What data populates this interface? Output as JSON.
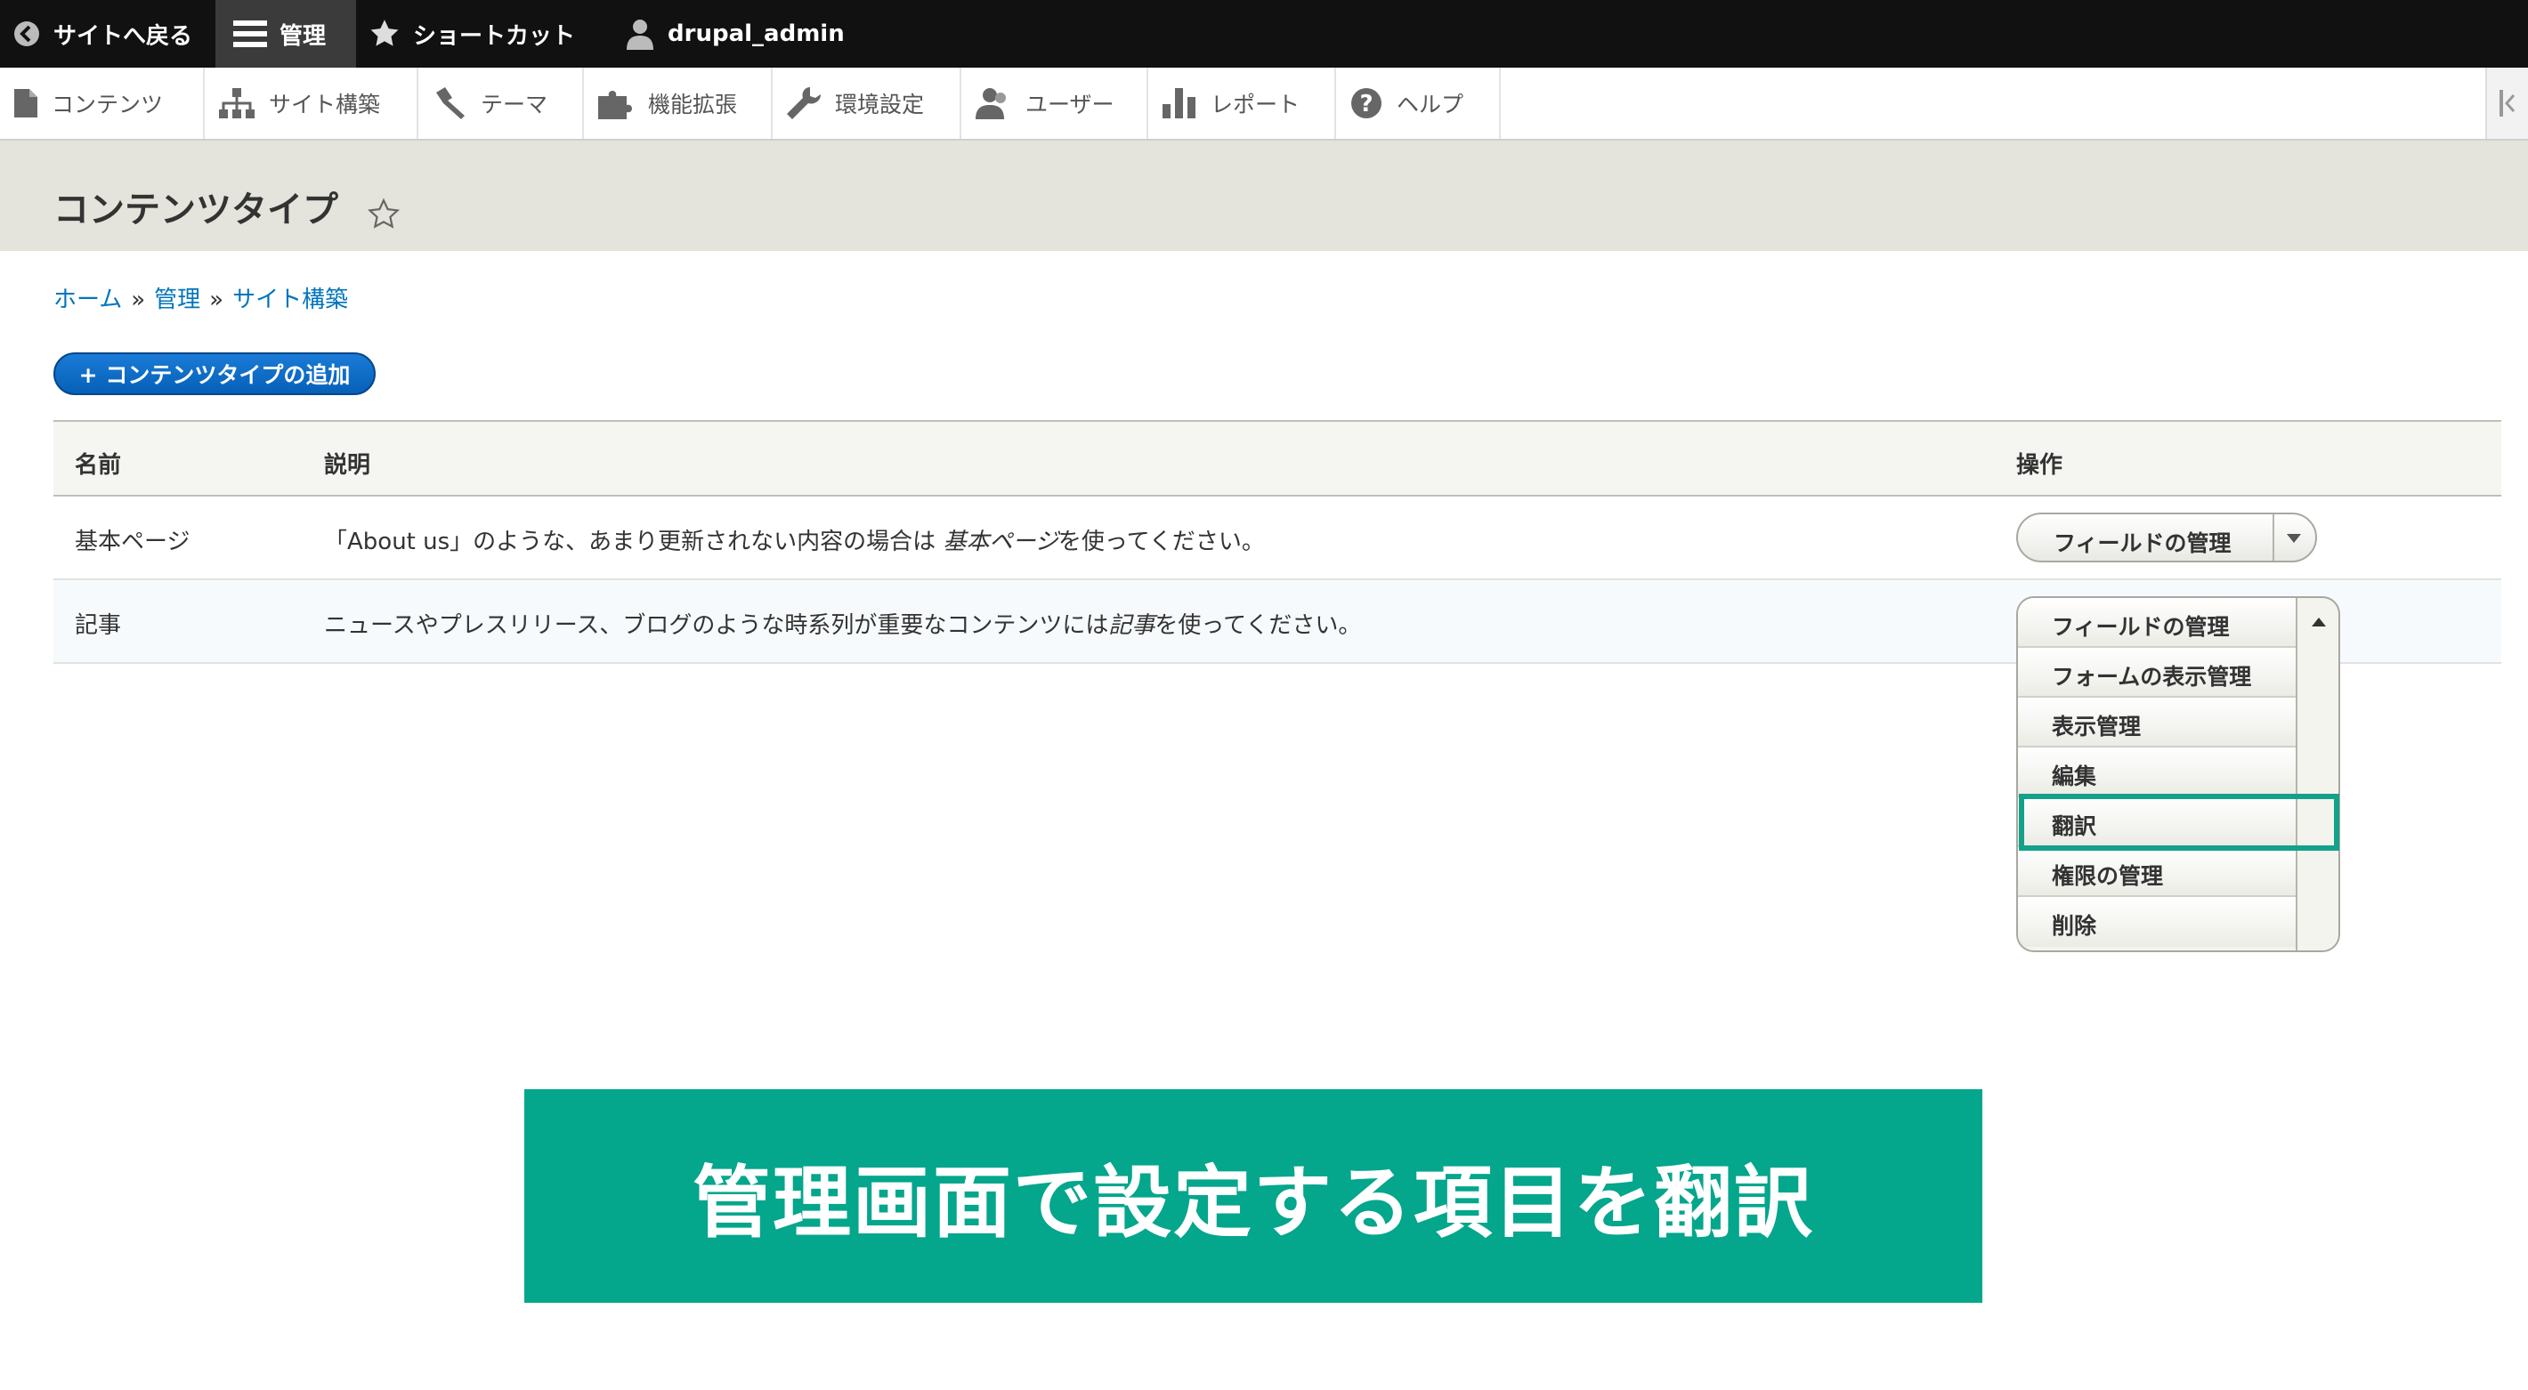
{
  "toolbar": {
    "back_to_site": "サイトへ戻る",
    "manage": "管理",
    "shortcuts": "ショートカット",
    "user": "drupal_admin"
  },
  "tray": {
    "items": [
      {
        "label": "コンテンツ",
        "icon": "file-icon"
      },
      {
        "label": "サイト構築",
        "icon": "sitemap-icon"
      },
      {
        "label": "テーマ",
        "icon": "paintbrush-icon"
      },
      {
        "label": "機能拡張",
        "icon": "puzzle-icon"
      },
      {
        "label": "環境設定",
        "icon": "wrench-icon"
      },
      {
        "label": "ユーザー",
        "icon": "people-icon"
      },
      {
        "label": "レポート",
        "icon": "bar-chart-icon"
      },
      {
        "label": "ヘルプ",
        "icon": "help-icon"
      }
    ]
  },
  "page": {
    "title": "コンテンツタイプ",
    "breadcrumb": [
      "ホーム",
      "管理",
      "サイト構築"
    ],
    "breadcrumb_sep": "»",
    "add_button": "+ コンテンツタイプの追加"
  },
  "table": {
    "headers": [
      "名前",
      "説明",
      "操作"
    ],
    "rows": [
      {
        "name": "基本ページ",
        "desc_pre": "「About us」のような、あまり更新されない内容の場合は ",
        "desc_em": "基本ページ",
        "desc_post": "を使ってください。"
      },
      {
        "name": "記事",
        "desc_pre": "ニュースやプレスリリース、ブログのような時系列が重要なコンテンツには",
        "desc_em": "記事",
        "desc_post": "を使ってください。"
      }
    ]
  },
  "dropbutton1": {
    "label": "フィールドの管理"
  },
  "dropbutton2": {
    "items": [
      "フィールドの管理",
      "フォームの表示管理",
      "表示管理",
      "編集",
      "翻訳",
      "権限の管理",
      "削除"
    ],
    "highlighted": "翻訳"
  },
  "banner": {
    "text": "管理画面で設定する項目を翻訳"
  },
  "colors": {
    "accent": "#0a66c2",
    "banner": "#04a68c",
    "highlight": "#13a18a",
    "toolbar": "#111111"
  }
}
